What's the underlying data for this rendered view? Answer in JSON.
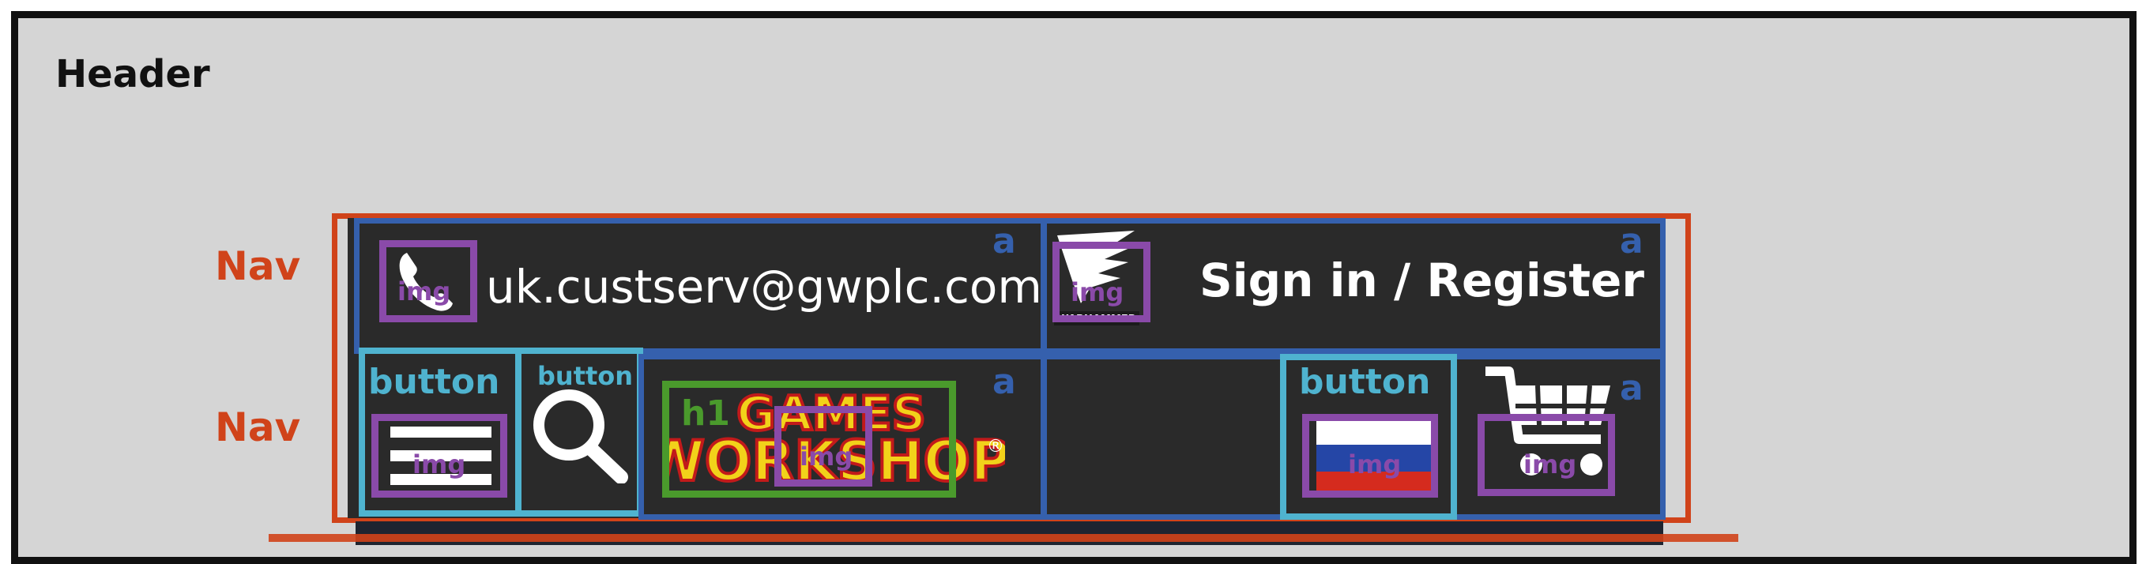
{
  "header": {
    "title": "Header"
  },
  "nav_labels": [
    "Nav",
    "Nav"
  ],
  "top_bar": {
    "email": "uk.custserv@gwplc.com",
    "sign_in": "Sign in / Register",
    "brand_small": "WARHAMMER"
  },
  "main_bar": {
    "logo_line1": "GAMES",
    "logo_line2": "WORKSHOP",
    "logo_registered": "®"
  },
  "annotations": {
    "a": "a",
    "img": "img",
    "button": "button",
    "h1": "h1"
  },
  "icons": [
    "phone-icon",
    "hamburger-menu-icon",
    "search-icon",
    "flag-icon",
    "cart-icon",
    "warhammer-logo-icon"
  ],
  "colors": {
    "header_border": "#111111",
    "header_bg": "#d5d5d5",
    "nav": "#d0431a",
    "anchor": "#3560ad",
    "image": "#8a4aa9",
    "button": "#4fb3cf",
    "heading": "#4a9a2c",
    "bar_bg": "#2a2a2a"
  }
}
